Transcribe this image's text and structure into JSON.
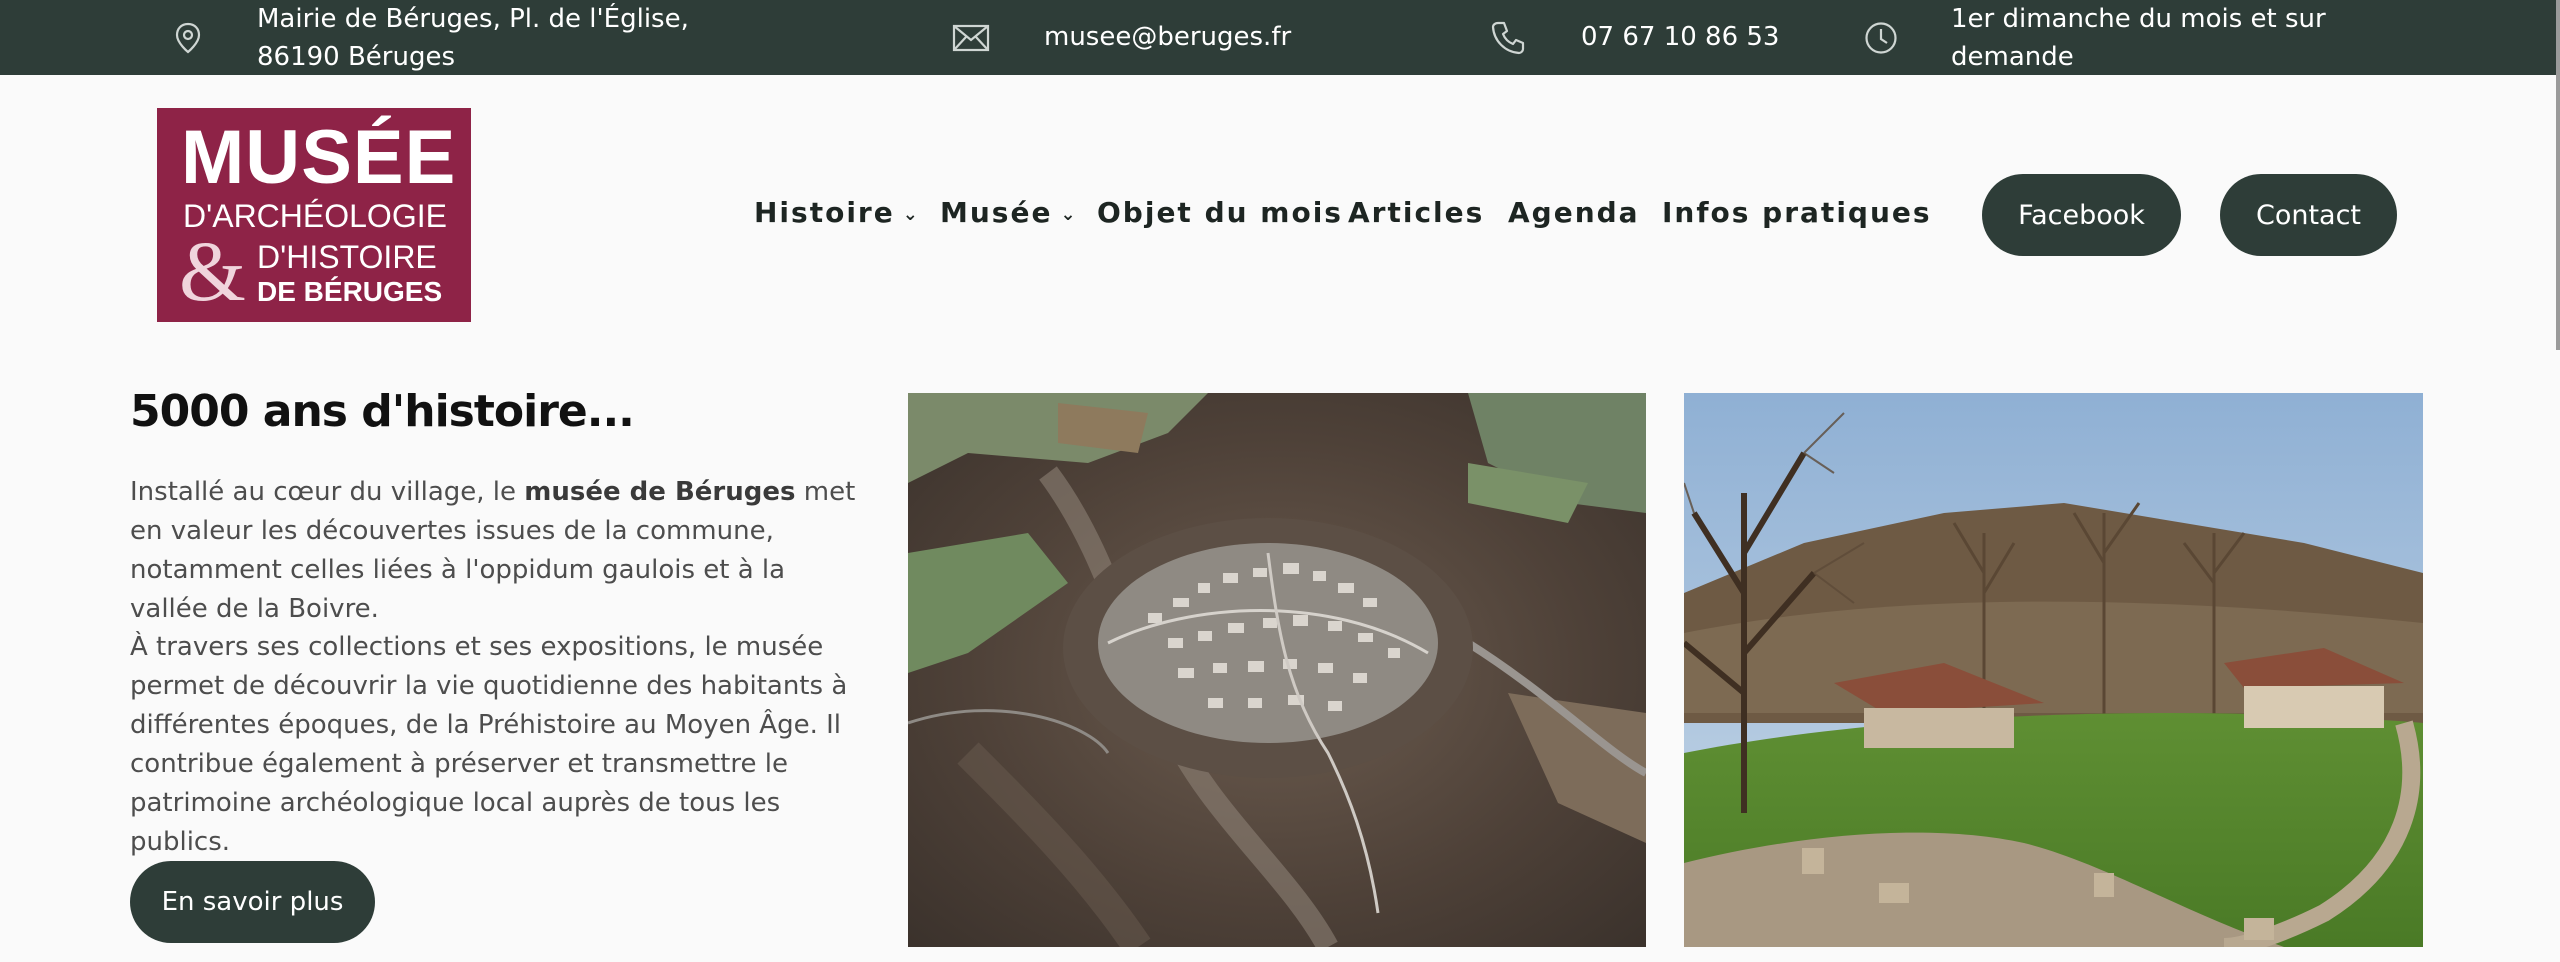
{
  "topbar": {
    "address": "Mairie de Béruges, Pl. de l'Église, 86190 Béruges",
    "email": "musee@beruges.fr",
    "phone": "07 67 10 86 53",
    "hours": "1er dimanche du mois et sur demande",
    "icons": [
      "map-pin-icon",
      "envelope-icon",
      "phone-icon",
      "clock-icon"
    ]
  },
  "logo": {
    "line1": "MUSÉE",
    "line2": "D'ARCHÉOLOGIE",
    "amp": "&",
    "line3": "D'HISTOIRE",
    "line4": "DE BÉRUGES",
    "color": "#8e2347"
  },
  "nav": {
    "items": [
      {
        "label": "Histoire",
        "dropdown": true
      },
      {
        "label": "Musée",
        "dropdown": true
      },
      {
        "label": "Objet du mois",
        "dropdown": false
      },
      {
        "label": "Articles",
        "dropdown": false
      },
      {
        "label": "Agenda",
        "dropdown": false
      },
      {
        "label": "Infos pratiques",
        "dropdown": false
      }
    ],
    "chevron": "⌄"
  },
  "header_buttons": {
    "facebook": "Facebook",
    "contact": "Contact"
  },
  "content": {
    "heading": "5000 ans d'histoire...",
    "p1_before": "Installé au cœur du village, le ",
    "p1_bold": "musée de Béruges",
    "p1_after": " met en valeur les découvertes issues de la commune, notamment celles liées à l'oppidum gaulois et à la vallée de la Boivre.",
    "p2": "À travers ses collections et ses expositions, le musée permet de découvrir la vie quotidienne des habitants à différentes époques, de la Préhistoire au Moyen Âge. Il contribue également à préserver et transmettre le patrimoine archéologique local auprès de tous les publics.",
    "cta": "En savoir plus"
  },
  "colors": {
    "dark_green": "#2e3d38",
    "brand": "#8e2347",
    "background": "#fafafa"
  }
}
